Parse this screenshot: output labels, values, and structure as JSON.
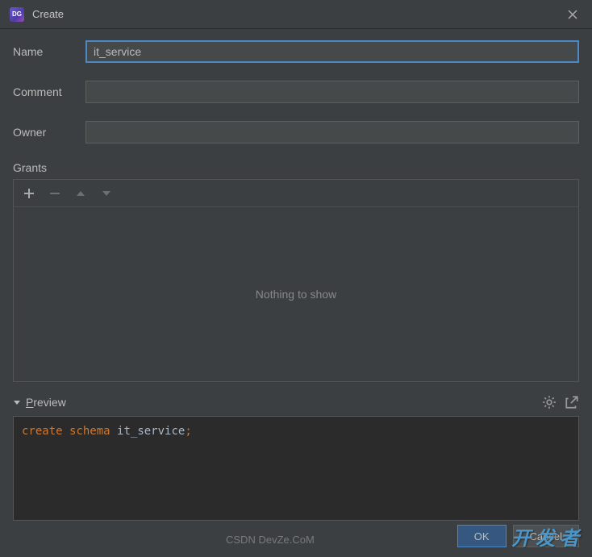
{
  "titlebar": {
    "app_icon_text": "DG",
    "title": "Create"
  },
  "form": {
    "name_label": "Name",
    "name_value": "it_service",
    "comment_label": "Comment",
    "comment_value": "",
    "owner_label": "Owner",
    "owner_value": ""
  },
  "grants": {
    "label": "Grants",
    "empty_text": "Nothing to show"
  },
  "preview": {
    "label_prefix": "P",
    "label_rest": "review",
    "sql_keyword1": "create",
    "sql_keyword2": "schema",
    "sql_identifier": "it_service",
    "sql_semi": ";"
  },
  "footer": {
    "ok": "OK",
    "cancel": "Cancel"
  },
  "watermark": {
    "csdn": "CSDN DevZe.CoM",
    "devze": "开发者"
  }
}
